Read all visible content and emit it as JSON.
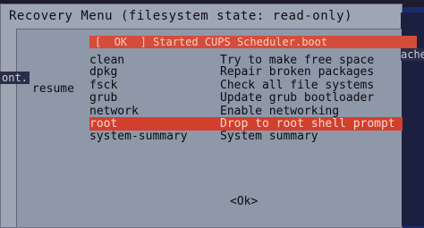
{
  "dialog": {
    "title": "Recovery Menu (filesystem state: read-only)",
    "background_log": "[  OK  ] Started CUPS Scheduler.boot",
    "right_fragment": "ache",
    "left_fragment": "ont.",
    "resume_label": "resume",
    "ok_button": "<Ok>"
  },
  "menu": [
    {
      "key": "clean",
      "desc": "Try to make free space"
    },
    {
      "key": "dpkg",
      "desc": "Repair broken packages"
    },
    {
      "key": "fsck",
      "desc": "Check all file systems"
    },
    {
      "key": "grub",
      "desc": "Update grub bootloader"
    },
    {
      "key": "network",
      "desc": "Enable networking"
    },
    {
      "key": "root",
      "desc": "Drop to root shell prompt",
      "selected": true
    },
    {
      "key": "system-summary",
      "desc": "System summary"
    }
  ],
  "colors": {
    "dialog_bg": "#9ea6b4",
    "selection_bg": "#d23f2c",
    "screen_bg": "#1a2a6e"
  }
}
